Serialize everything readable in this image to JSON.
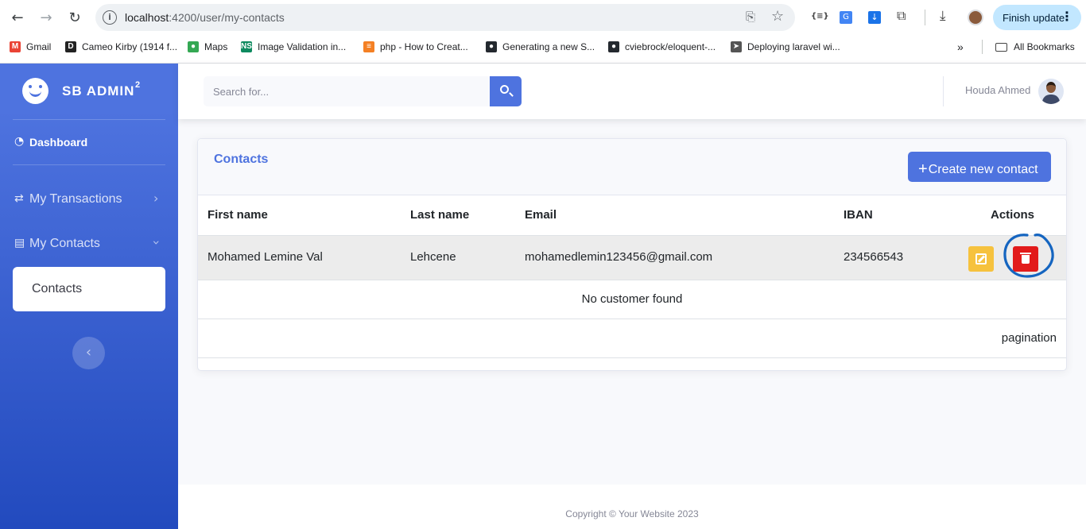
{
  "browser": {
    "url_host": "localhost",
    "url_path": ":4200/user/my-contacts",
    "finish_update": "Finish update",
    "bookmarks": [
      {
        "label": "Gmail",
        "icon": "gmail-icon",
        "color": "#ea4335",
        "glyph": "M"
      },
      {
        "label": "Cameo Kirby (1914 f...",
        "icon": "d-icon",
        "color": "#222222",
        "glyph": "D"
      },
      {
        "label": "Maps",
        "icon": "maps-icon",
        "color": "#34a853",
        "glyph": "●"
      },
      {
        "label": "Image Validation in...",
        "icon": "ns-icon",
        "color": "#0e8a5f",
        "glyph": "NS"
      },
      {
        "label": "php - How to Creat...",
        "icon": "stackoverflow-icon",
        "color": "#f48024",
        "glyph": "≡"
      },
      {
        "label": "Generating a new S...",
        "icon": "github-icon",
        "color": "#24292f",
        "glyph": "●"
      },
      {
        "label": "cviebrock/eloquent-...",
        "icon": "github-icon",
        "color": "#24292f",
        "glyph": "●"
      },
      {
        "label": "Deploying laravel wi...",
        "icon": "send-icon",
        "color": "#555555",
        "glyph": "➤"
      }
    ],
    "all_bookmarks": "All Bookmarks"
  },
  "sidebar": {
    "brand": "SB ADMIN",
    "brand_sup": "2",
    "dashboard": "Dashboard",
    "transactions": "My Transactions",
    "contacts_group": "My Contacts",
    "contacts_item": "Contacts"
  },
  "topbar": {
    "search_placeholder": "Search for...",
    "user_name": "Houda Ahmed"
  },
  "card": {
    "title": "Contacts",
    "create_label": "Create new contact",
    "headers": [
      "First name",
      "Last name",
      "Email",
      "IBAN",
      "Actions"
    ],
    "rows": [
      {
        "first_name": "Mohamed Lemine Val",
        "last_name": "Lehcene",
        "email": "mohamedlemin123456@gmail.com",
        "iban": "234566543"
      }
    ],
    "empty_message": "No customer found",
    "pagination": "pagination"
  },
  "footer": {
    "copyright": "Copyright © Your Website 2023"
  },
  "colors": {
    "primary": "#4e73df",
    "warning": "#f6c23e",
    "danger": "#e21b1b",
    "annotation": "#1565c0"
  }
}
